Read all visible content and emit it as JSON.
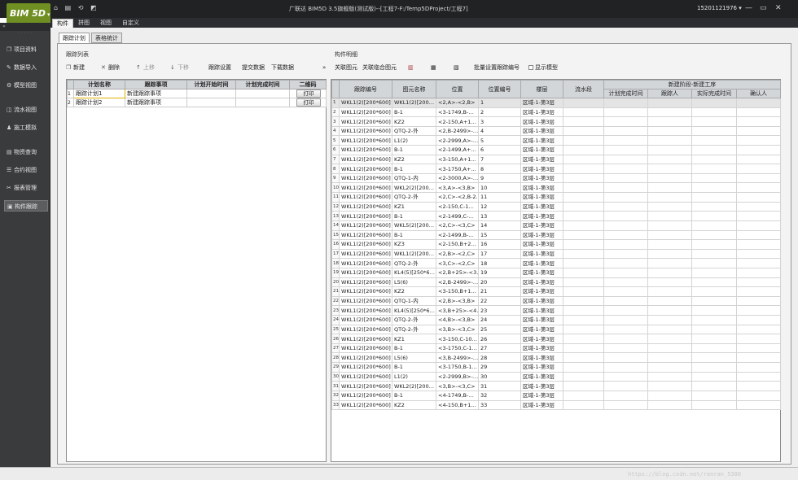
{
  "app": {
    "logo": "BIM 5D",
    "logo_arrow": "▾",
    "title": "广联达 BIM5D 3.5旗舰版(测试版)--[工程7-F:/Temp5DProject/工程7]",
    "user": "15201121976 ▾",
    "quick_access": "⌂ ▤ ⟲ ◩"
  },
  "window_controls": {
    "minimize": "—",
    "restore": "▭",
    "close": "✕"
  },
  "menu": {
    "items": [
      "构件",
      "拼图",
      "视图",
      "自定义"
    ]
  },
  "sidebar": {
    "collapse": "«",
    "dots": "· · · · ·",
    "items": [
      {
        "label": "项目资料",
        "icon": "❐"
      },
      {
        "label": "数据导入",
        "icon": "✎"
      },
      {
        "label": "模型视图",
        "icon": "⚙"
      },
      {
        "label": "流水视图",
        "icon": "◫"
      },
      {
        "label": "施工模拟",
        "icon": "♟"
      },
      {
        "label": "物资查询",
        "icon": "▤"
      },
      {
        "label": "合约视图",
        "icon": "☰"
      },
      {
        "label": "报表管理",
        "icon": "✂"
      },
      {
        "label": "构件跟踪",
        "icon": "▣"
      }
    ]
  },
  "page_tabs": [
    "跟踪计划",
    "表格统计"
  ],
  "left": {
    "section": "跟踪列表",
    "toolbar": [
      {
        "label": "新建",
        "icon": "❐"
      },
      {
        "label": "删除",
        "icon": "✕"
      },
      {
        "label": "上移",
        "icon": "↑"
      },
      {
        "label": "下移",
        "icon": "↓"
      },
      {
        "label": "跟踪设置",
        "icon": ""
      },
      {
        "label": "提交数据",
        "icon": ""
      },
      {
        "label": "下载数据",
        "icon": ""
      }
    ],
    "more": "»",
    "columns": [
      "计划名称",
      "跟踪事项",
      "计划开始时间",
      "计划完成时间",
      "二维码"
    ],
    "rows": [
      {
        "n": "1",
        "name": "跟踪计划1",
        "item": "新建跟踪事项",
        "start": "",
        "end": "",
        "btn": "打印"
      },
      {
        "n": "2",
        "name": "跟踪计划2",
        "item": "新建跟踪事项",
        "start": "",
        "end": "",
        "btn": "打印"
      }
    ]
  },
  "right": {
    "section": "构件明细",
    "toolbar": [
      {
        "label": "关联图元",
        "icon": ""
      },
      {
        "label": "关联临合图元",
        "icon": ""
      },
      {
        "label": "",
        "icon": "▥"
      },
      {
        "label": "",
        "icon": "▦"
      },
      {
        "label": "",
        "icon": "▧"
      },
      {
        "label": "批量设置跟踪编号",
        "icon": ""
      }
    ],
    "show_model": "显示模型",
    "headers": {
      "track_no": "跟踪编号",
      "elem_name": "图元名称",
      "position": "位置",
      "pos_no": "位置编号",
      "floor": "楼层",
      "flow": "流水段",
      "group": "新建阶段-新建工序",
      "plan_end": "计划完成时间",
      "owner": "跟踪人",
      "actual_end": "实际完成时间",
      "confirm": "确认人"
    },
    "rows": [
      [
        "1",
        "WKL1(2)[200*600]",
        "WKL1(2)[200…",
        "<2,A>-<2,B>",
        "1",
        "区域-1-第3层"
      ],
      [
        "2",
        "WKL1(2)[200*600]",
        "B-1",
        "<3-1749,B-…",
        "2",
        "区域-1-第3层"
      ],
      [
        "3",
        "WKL1(2)[200*600]",
        "KZ2",
        "<2-150,A+1…",
        "3",
        "区域-1-第3层"
      ],
      [
        "4",
        "WKL1(2)[200*600]",
        "QTQ-2-外",
        "<2,B-2499>-…",
        "4",
        "区域-1-第3层"
      ],
      [
        "5",
        "WKL1(2)[200*600]",
        "L1(2)",
        "<2-2999,A>-…",
        "5",
        "区域-1-第3层"
      ],
      [
        "6",
        "WKL1(2)[200*600]",
        "B-1",
        "<2-1499,A+…",
        "6",
        "区域-1-第3层"
      ],
      [
        "7",
        "WKL1(2)[200*600]",
        "KZ2",
        "<3-150,A+1…",
        "7",
        "区域-1-第3层"
      ],
      [
        "8",
        "WKL1(2)[200*600]",
        "B-1",
        "<3-1750,A+…",
        "8",
        "区域-1-第3层"
      ],
      [
        "9",
        "WKL1(2)[200*600]",
        "QTQ-1-内",
        "<2-3000,A>-…",
        "9",
        "区域-1-第3层"
      ],
      [
        "10",
        "WKL1(2)[200*600]",
        "WKL2(2)[200…",
        "<3,A>-<3,B>",
        "10",
        "区域-1-第3层"
      ],
      [
        "11",
        "WKL1(2)[200*600]",
        "QTQ-2-外",
        "<2,C>-<2,B-2…",
        "11",
        "区域-1-第3层"
      ],
      [
        "12",
        "WKL1(2)[200*600]",
        "KZ1",
        "<2-150,C-1…",
        "12",
        "区域-1-第3层"
      ],
      [
        "13",
        "WKL1(2)[200*600]",
        "B-1",
        "<2-1499,C-…",
        "13",
        "区域-1-第3层"
      ],
      [
        "14",
        "WKL1(2)[200*600]",
        "WKL5(2)[200…",
        "<2,C>-<3,C>",
        "14",
        "区域-1-第3层"
      ],
      [
        "15",
        "WKL1(2)[200*600]",
        "B-1",
        "<2-1499,B-…",
        "15",
        "区域-1-第3层"
      ],
      [
        "16",
        "WKL1(2)[200*600]",
        "KZ3",
        "<2-150,B+2…",
        "16",
        "区域-1-第3层"
      ],
      [
        "17",
        "WKL1(2)[200*600]",
        "WKL1(2)[200…",
        "<2,B>-<2,C>",
        "17",
        "区域-1-第3层"
      ],
      [
        "18",
        "WKL1(2)[200*600]",
        "QTQ-2-外",
        "<3,C>-<2,C>",
        "18",
        "区域-1-第3层"
      ],
      [
        "19",
        "WKL1(2)[200*600]",
        "KL4(5)[250*6…",
        "<2,B+25>-<3…",
        "19",
        "区域-1-第3层"
      ],
      [
        "20",
        "WKL1(2)[200*600]",
        "L5(6)",
        "<2,B-2499>-…",
        "20",
        "区域-1-第3层"
      ],
      [
        "21",
        "WKL1(2)[200*600]",
        "KZ2",
        "<3-150,B+1…",
        "21",
        "区域-1-第3层"
      ],
      [
        "22",
        "WKL1(2)[200*600]",
        "QTQ-1-内",
        "<2,B>-<3,B>",
        "22",
        "区域-1-第3层"
      ],
      [
        "23",
        "WKL1(2)[200*600]",
        "KL4(5)[250*6…",
        "<3,B+25>-<4…",
        "23",
        "区域-1-第3层"
      ],
      [
        "24",
        "WKL1(2)[200*600]",
        "QTQ-2-外",
        "<4,B>-<3,B>",
        "24",
        "区域-1-第3层"
      ],
      [
        "25",
        "WKL1(2)[200*600]",
        "QTQ-2-外",
        "<3,B>-<3,C>",
        "25",
        "区域-1-第3层"
      ],
      [
        "26",
        "WKL1(2)[200*600]",
        "KZ1",
        "<3-150,C-10…",
        "26",
        "区域-1-第3层"
      ],
      [
        "27",
        "WKL1(2)[200*600]",
        "B-1",
        "<3-1750,C-1…",
        "27",
        "区域-1-第3层"
      ],
      [
        "28",
        "WKL1(2)[200*600]",
        "L5(6)",
        "<3,B-2499>-…",
        "28",
        "区域-1-第3层"
      ],
      [
        "29",
        "WKL1(2)[200*600]",
        "B-1",
        "<3-1750,B-1…",
        "29",
        "区域-1-第3层"
      ],
      [
        "30",
        "WKL1(2)[200*600]",
        "L1(2)",
        "<2-2999,B>-…",
        "30",
        "区域-1-第3层"
      ],
      [
        "31",
        "WKL1(2)[200*600]",
        "WKL2(2)[200…",
        "<3,B>-<3,C>",
        "31",
        "区域-1-第3层"
      ],
      [
        "32",
        "WKL1(2)[200*600]",
        "B-1",
        "<4-1749,B-…",
        "32",
        "区域-1-第3层"
      ],
      [
        "33",
        "WKL1(2)[200*600]",
        "KZ2",
        "<4-150,B+1…",
        "33",
        "区域-1-第3层"
      ]
    ]
  },
  "watermark": "https://blog.csdn.net/ranran_5380"
}
